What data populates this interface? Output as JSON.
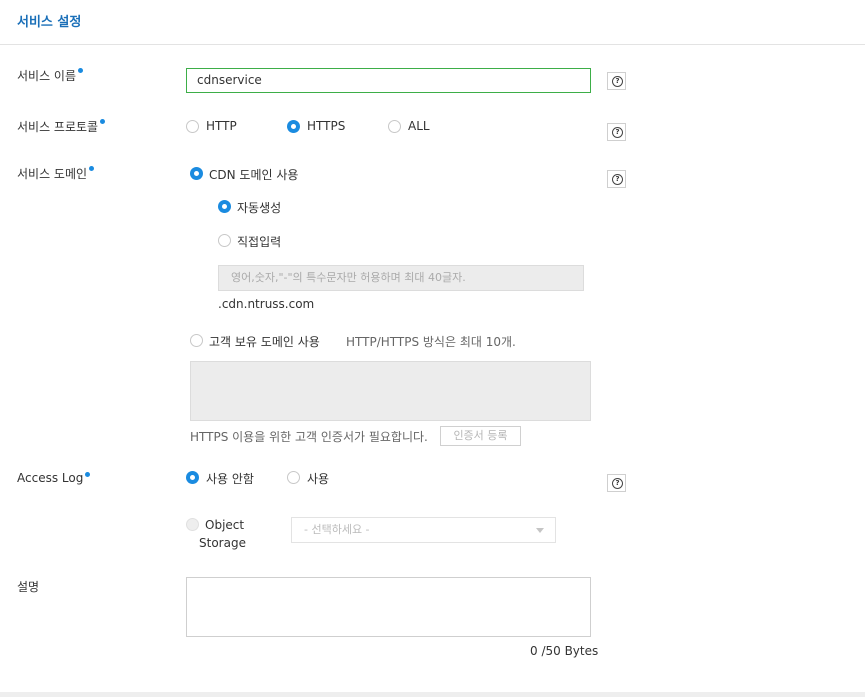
{
  "header": {
    "title": "서비스 설정"
  },
  "service_name": {
    "label": "서비스 이름",
    "value": "cdnservice"
  },
  "service_protocol": {
    "label": "서비스 프로토콜",
    "options": [
      "HTTP",
      "HTTPS",
      "ALL"
    ],
    "selected": "HTTPS"
  },
  "service_domain": {
    "label": "서비스 도메인",
    "cdn_domain_label": "CDN 도메인 사용",
    "auto_generate_label": "자동생성",
    "manual_input_label": "직접입력",
    "manual_input_placeholder": "영어,숫자,\"-\"의 특수문자만 허용하며 최대 40글자.",
    "domain_suffix": ".cdn.ntruss.com",
    "custom_domain_label": "고객 보유 도메인 사용",
    "custom_domain_note": "HTTP/HTTPS 방식은 최대 10개.",
    "https_cert_note": "HTTPS 이용을 위한 고객 인증서가 필요합니다.",
    "cert_register_button": "인증서 등록"
  },
  "access_log": {
    "label": "Access Log",
    "off_label": "사용 안함",
    "on_label": "사용",
    "object_storage_line1": "Object",
    "object_storage_line2": "Storage",
    "select_placeholder": "- 선택하세요 -"
  },
  "description": {
    "label": "설명",
    "byte_counter": "0 /50 Bytes"
  },
  "icons": {
    "help": "help-icon",
    "dropdown": "chevron-down-icon"
  },
  "colors": {
    "accent": "#1a8be0",
    "title": "#1a6fb8",
    "input_focus_border": "#3dae48"
  }
}
